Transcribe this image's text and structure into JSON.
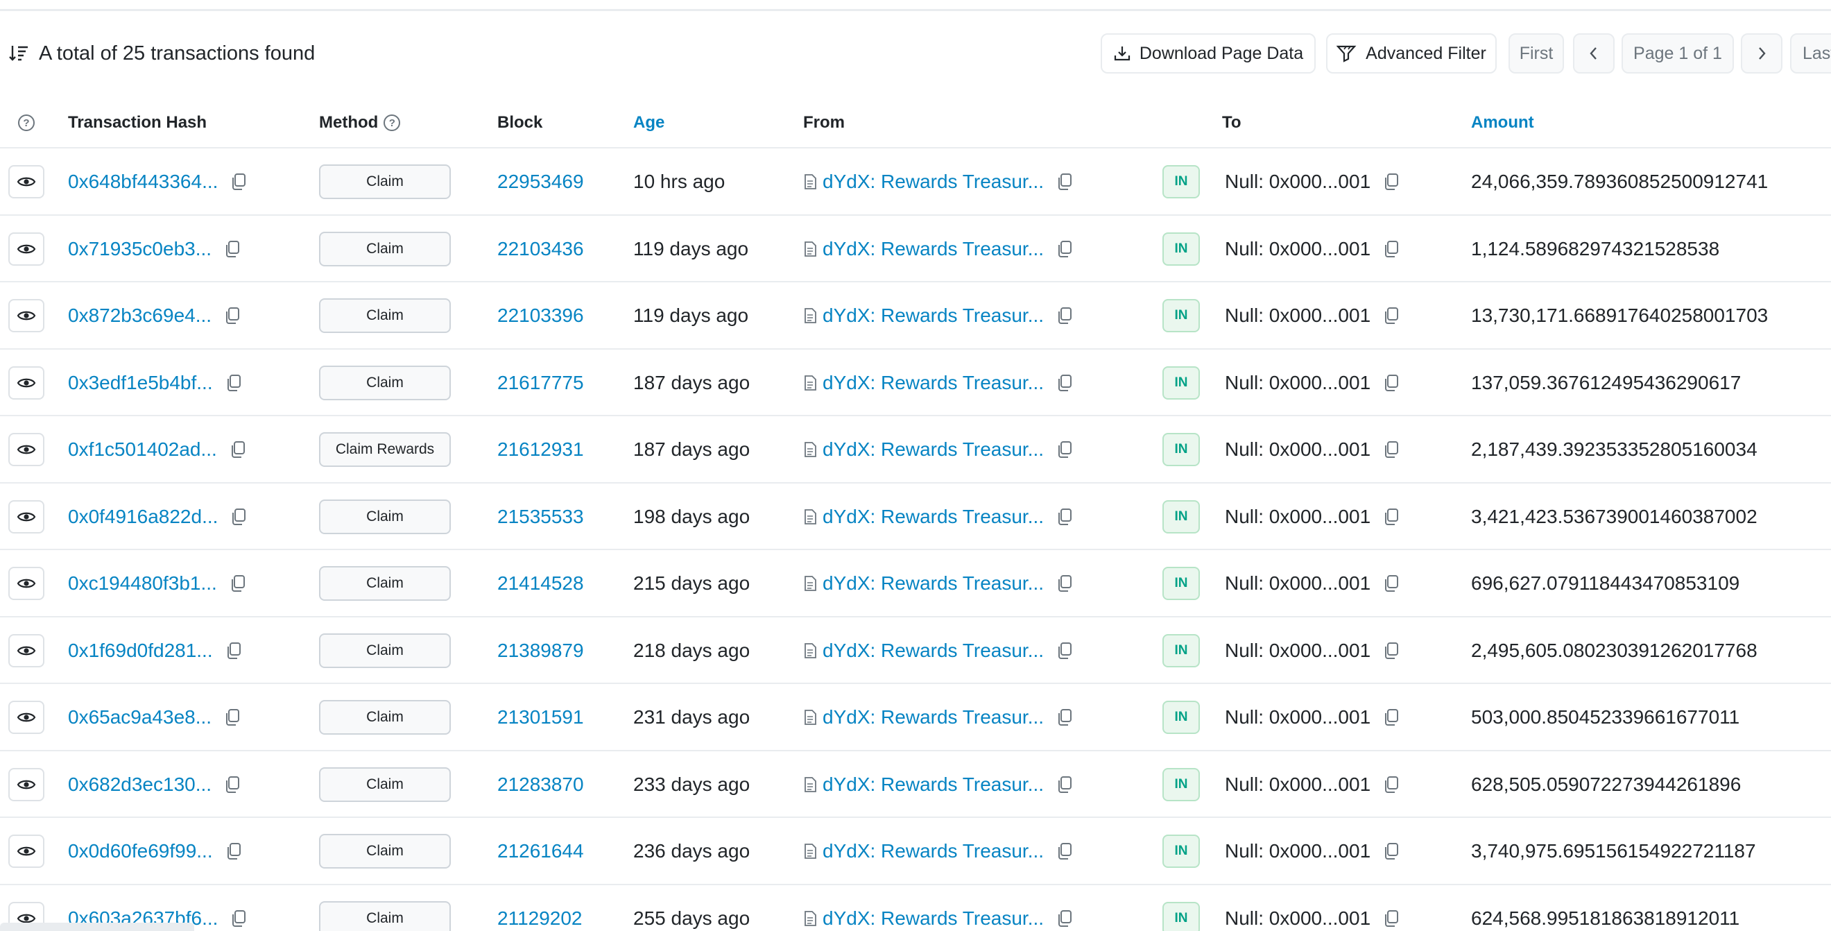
{
  "header": {
    "total_text": "A total of 25 transactions found",
    "download_label": "Download Page Data",
    "filter_label": "Advanced Filter",
    "first_label": "First",
    "page_label": "Page 1 of 1",
    "last_label": "Last"
  },
  "columns": {
    "tx_hash": "Transaction Hash",
    "method": "Method",
    "block": "Block",
    "age": "Age",
    "from": "From",
    "to": "To",
    "amount": "Amount"
  },
  "rows": [
    {
      "hash": "0x648bf443364...",
      "method": "Claim",
      "block": "22953469",
      "age": "10 hrs ago",
      "from": "dYdX: Rewards Treasur...",
      "direction": "IN",
      "to": "Null: 0x000...001",
      "amount": "24,066,359.789360852500912741"
    },
    {
      "hash": "0x71935c0eb3...",
      "method": "Claim",
      "block": "22103436",
      "age": "119 days ago",
      "from": "dYdX: Rewards Treasur...",
      "direction": "IN",
      "to": "Null: 0x000...001",
      "amount": "1,124.589682974321528538"
    },
    {
      "hash": "0x872b3c69e4...",
      "method": "Claim",
      "block": "22103396",
      "age": "119 days ago",
      "from": "dYdX: Rewards Treasur...",
      "direction": "IN",
      "to": "Null: 0x000...001",
      "amount": "13,730,171.668917640258001703"
    },
    {
      "hash": "0x3edf1e5b4bf...",
      "method": "Claim",
      "block": "21617775",
      "age": "187 days ago",
      "from": "dYdX: Rewards Treasur...",
      "direction": "IN",
      "to": "Null: 0x000...001",
      "amount": "137,059.367612495436290617"
    },
    {
      "hash": "0xf1c501402ad...",
      "method": "Claim Rewards",
      "block": "21612931",
      "age": "187 days ago",
      "from": "dYdX: Rewards Treasur...",
      "direction": "IN",
      "to": "Null: 0x000...001",
      "amount": "2,187,439.392353352805160034"
    },
    {
      "hash": "0x0f4916a822d...",
      "method": "Claim",
      "block": "21535533",
      "age": "198 days ago",
      "from": "dYdX: Rewards Treasur...",
      "direction": "IN",
      "to": "Null: 0x000...001",
      "amount": "3,421,423.536739001460387002"
    },
    {
      "hash": "0xc194480f3b1...",
      "method": "Claim",
      "block": "21414528",
      "age": "215 days ago",
      "from": "dYdX: Rewards Treasur...",
      "direction": "IN",
      "to": "Null: 0x000...001",
      "amount": "696,627.079118443470853109"
    },
    {
      "hash": "0x1f69d0fd281...",
      "method": "Claim",
      "block": "21389879",
      "age": "218 days ago",
      "from": "dYdX: Rewards Treasur...",
      "direction": "IN",
      "to": "Null: 0x000...001",
      "amount": "2,495,605.080230391262017768"
    },
    {
      "hash": "0x65ac9a43e8...",
      "method": "Claim",
      "block": "21301591",
      "age": "231 days ago",
      "from": "dYdX: Rewards Treasur...",
      "direction": "IN",
      "to": "Null: 0x000...001",
      "amount": "503,000.850452339661677011"
    },
    {
      "hash": "0x682d3ec130...",
      "method": "Claim",
      "block": "21283870",
      "age": "233 days ago",
      "from": "dYdX: Rewards Treasur...",
      "direction": "IN",
      "to": "Null: 0x000...001",
      "amount": "628,505.059072273944261896"
    },
    {
      "hash": "0x0d60fe69f99...",
      "method": "Claim",
      "block": "21261644",
      "age": "236 days ago",
      "from": "dYdX: Rewards Treasur...",
      "direction": "IN",
      "to": "Null: 0x000...001",
      "amount": "3,740,975.695156154922721187"
    },
    {
      "hash": "0x603a2637bf6...",
      "method": "Claim",
      "block": "21129202",
      "age": "255 days ago",
      "from": "dYdX: Rewards Treasur...",
      "direction": "IN",
      "to": "Null: 0x000...001",
      "amount": "624,568.995181863818912011"
    }
  ]
}
